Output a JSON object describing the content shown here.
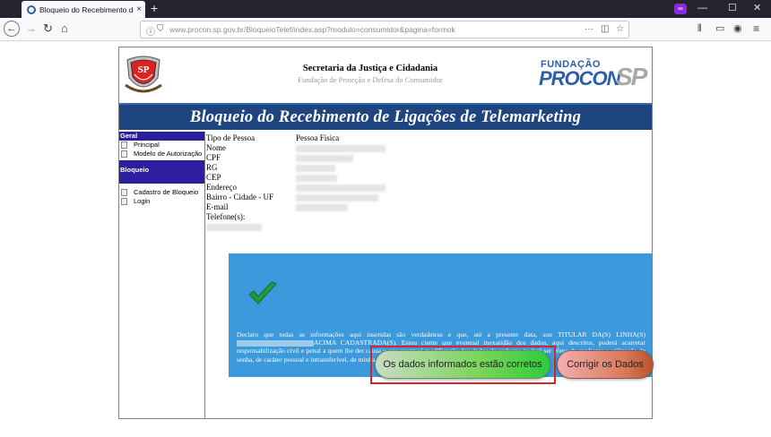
{
  "browser": {
    "tab_title": "Bloqueio do Recebimento de",
    "tab_close": "×",
    "new_tab": "+",
    "url": "www.procon.sp.gov.br/BloqueioTelef/index.asp?modulo=consumidor&pagina=formok",
    "window_controls": {
      "minimize": "—",
      "maximize": "☐",
      "close": "✕"
    }
  },
  "header": {
    "title": "Secretaria da Justiça e Cidadania",
    "subtitle": "Fundação de Proteção e Defesa do Consumidor",
    "logo_fundacao": "FUNDAÇÃO",
    "logo_procon": "PROCON",
    "logo_sp": "SP",
    "seal_text": "SP"
  },
  "banner": {
    "title": "Bloqueio do Recebimento de Ligações de Telemarketing"
  },
  "sidebar": {
    "section_general": "Geral",
    "general_items": [
      {
        "label": "Principal"
      },
      {
        "label": "Modelo de Autorização"
      }
    ],
    "section_block": "Bloqueio",
    "block_items": [
      {
        "label": "Cadastro de Bloqueio"
      },
      {
        "label": "Login"
      }
    ]
  },
  "form_summary": {
    "rows": [
      {
        "label": "Tipo de Pessoa",
        "value": "Pessoa Física"
      },
      {
        "label": "Nome",
        "value": ""
      },
      {
        "label": "CPF",
        "value": ""
      },
      {
        "label": "RG",
        "value": ""
      },
      {
        "label": "CEP",
        "value": ""
      },
      {
        "label": "Endereço",
        "value": ""
      },
      {
        "label": "Bairro - Cidade - UF",
        "value": ""
      },
      {
        "label": "E-mail",
        "value": ""
      },
      {
        "label": "Telefone(s):",
        "value": ""
      }
    ]
  },
  "declaration": {
    "text_before": "Declaro que todas as informações aqui inseridas são verdadeiras e que, até a presente data, sou TITULAR DA(S) LINHA(S)",
    "text_after": "ACIMA CADASTRADA(S). Estou ciente que eventual inexatidão dos dados, aqui descritos, poderá acarretar responsabilização civil e penal a quem lhe der causa e que eventual modificação dos dados do cadastro poderá ser efetuada mediante a utilização da senha, de caráter pessoal e intransferível, de minha inteira responsabilidade."
  },
  "buttons": {
    "confirm": "Os dados informados estão corretos",
    "correct": "Corrigir os Dados"
  },
  "colors": {
    "banner": "#1f4580",
    "sidebar_header": "#2b1ea0",
    "declaration_box": "#3b99dc",
    "confirm_button": "#2ccc3a",
    "correct_button": "#d97a5a",
    "highlight": "#d3262a"
  }
}
